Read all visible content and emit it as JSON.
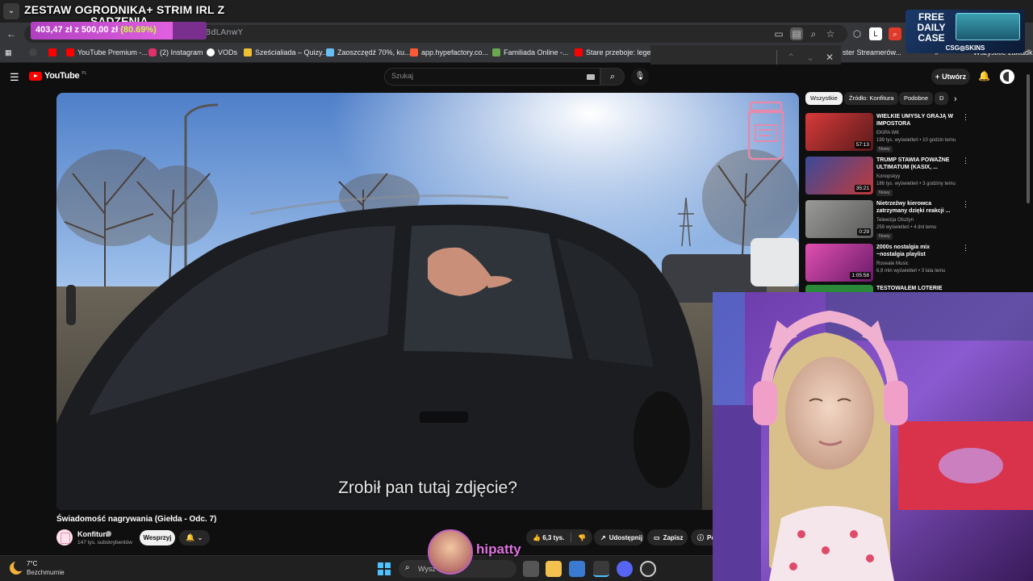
{
  "overlay": {
    "title_line1": "ZESTAW OGRODNIKA+ STRIM IRL Z",
    "title_line2": "SADZENIA",
    "goal_amount": "403,47 zł z 500,00 zł",
    "goal_percent": "(80.69%)",
    "goal_fraction": 0.8069,
    "ad_free": "FREE DAILY CASE",
    "ad_label": "CSG◎SKINS",
    "streamer_name": "hipatty"
  },
  "browser": {
    "url_fragment": "oVtNBdLAnwY",
    "bookmarks": [
      {
        "label": "YouTube Premium -...",
        "color": "#ff0000"
      },
      {
        "label": "(2) Instagram",
        "color": "#e1306c"
      },
      {
        "label": "VODs",
        "color": "#ffffff"
      },
      {
        "label": "Sześcialiada – Quizy...",
        "color": "#f0c030"
      },
      {
        "label": "Zaoszczędź 70%, ku...",
        "color": "#66c0f4"
      },
      {
        "label": "app.hypefactory.co...",
        "color": "#ff5a36"
      },
      {
        "label": "Familiada Online -...",
        "color": "#6aa84f"
      },
      {
        "label": "Stare przeboje: lege...",
        "color": "#ff0000"
      }
    ],
    "bookmark_right": "ster Streamerów...",
    "bookmark_all": "Wszystkie zakładki"
  },
  "youtube": {
    "logo_text": "YouTube",
    "logo_country": "PL",
    "search_placeholder": "Szukaj",
    "create_label": "Utwórz",
    "video_title": "Świadomość nagrywania (Giełda - Odc. 7)",
    "subtitle": "Zrobił pan tutaj zdjęcie?",
    "channel_name": "Konfitura",
    "channel_subs": "147 tys. subskrybentów",
    "support_label": "Wesprzyj",
    "likes": "6,3 tys.",
    "share_label": "Udostępnij",
    "save_label": "Zapisz",
    "more_label": "Po",
    "chips": [
      "Wszystkie",
      "Źródło: Konfitura",
      "Podobne",
      "D"
    ],
    "recommendations": [
      {
        "title": "WIELKIE UMYSŁY GRAJĄ W IMPOSTORA",
        "channel": "EKIPA WK",
        "meta": "199 tys. wyświetleń • 10 godzin temu",
        "badge": "Nowy",
        "duration": "57:13",
        "thumb": "#b02a2a"
      },
      {
        "title": "TRUMP STAWIA POWAŻNE ULTIMATUM (KASIX, ...",
        "channel": "Konopskyy",
        "meta": "186 tys. wyświetleń • 3 godziny temu",
        "badge": "Nowy",
        "duration": "35:21",
        "thumb": "#3a4a8a"
      },
      {
        "title": "Nietrzeźwy kierowca zatrzymany dzięki reakcji ...",
        "channel": "Telewizja Olsztyn",
        "meta": "259 wyświetleń • 4 dni temu",
        "badge": "Nowy",
        "duration": "0:29",
        "thumb": "#8a8a88"
      },
      {
        "title": "2000s nostalgia mix ~nostalgia playlist",
        "channel": "Roseate Music",
        "meta": "6,9 mln wyświetleń • 3 lata temu",
        "badge": "",
        "duration": "1:05:58",
        "thumb": "#c03a8a"
      },
      {
        "title": "TESTOWAŁEM LOTERIE PRZEZ",
        "channel": "",
        "meta": "",
        "badge": "",
        "duration": "",
        "thumb": "#2a8a3a"
      }
    ]
  },
  "taskbar": {
    "temp": "7°C",
    "weather": "Bezchmurnie",
    "search_placeholder": "Wysz"
  }
}
